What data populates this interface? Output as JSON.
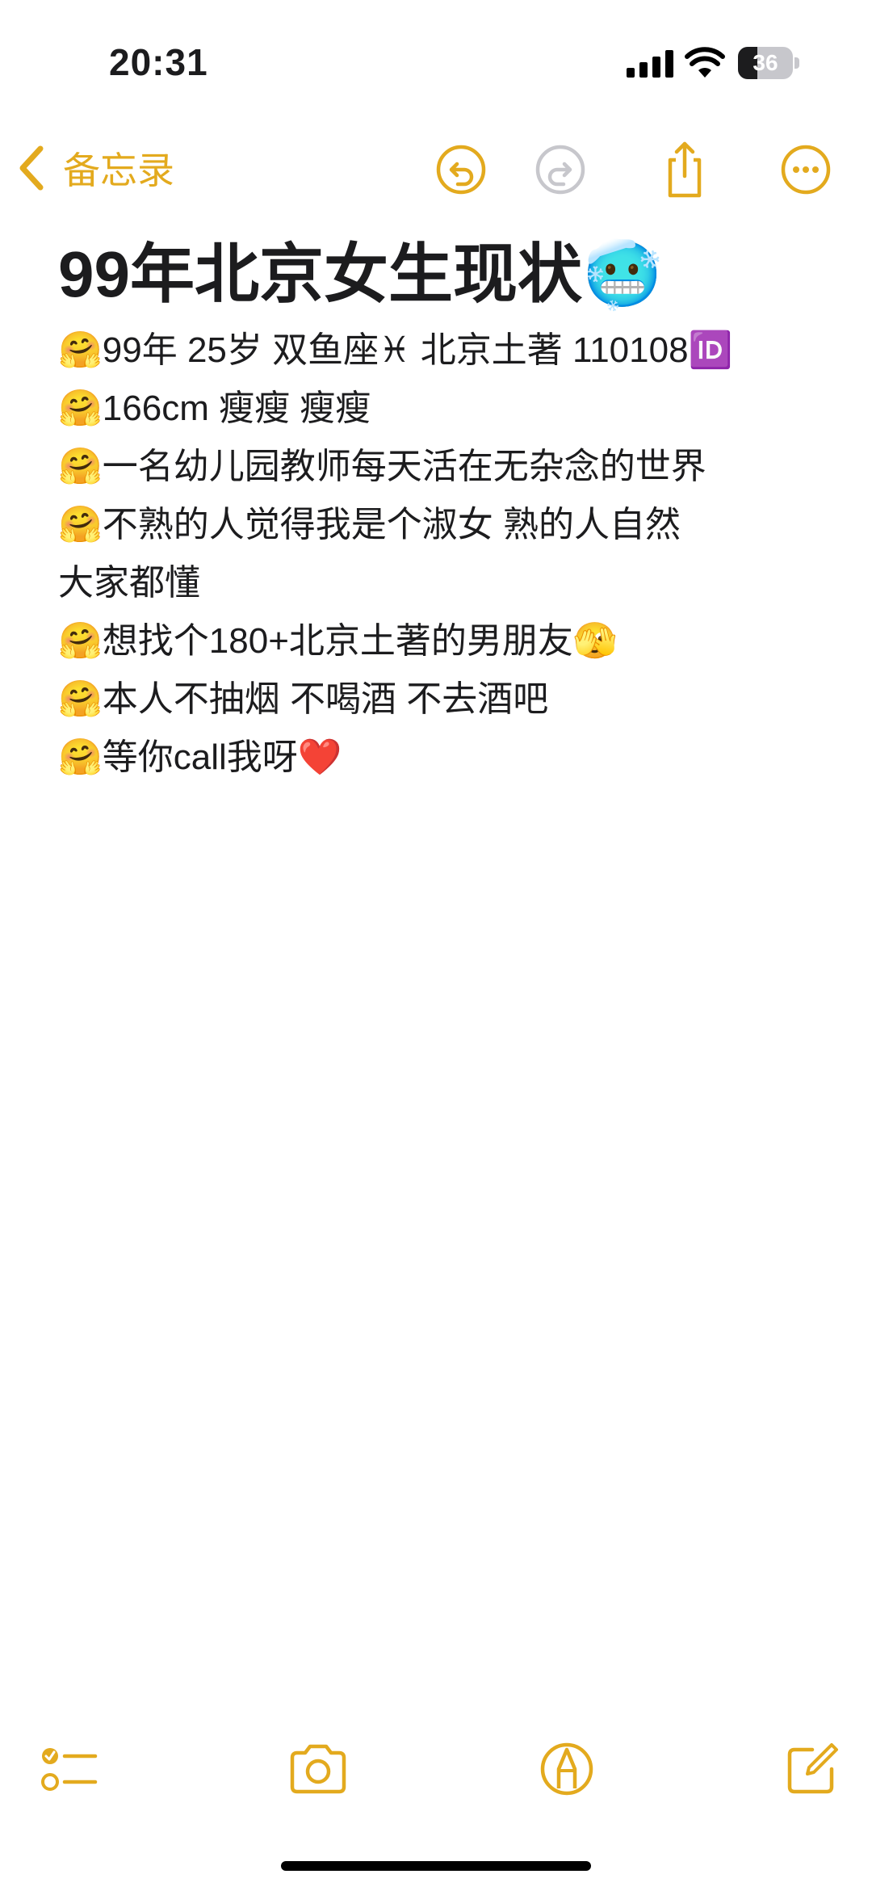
{
  "status": {
    "time": "20:31",
    "battery_text": "36",
    "battery_level": 0.36
  },
  "nav": {
    "back_label": "备忘录",
    "accent": "#e3aa1e",
    "icons": [
      "undo-icon",
      "redo-icon",
      "share-icon",
      "more-icon"
    ]
  },
  "note": {
    "title": "99年北京女生现状🥶",
    "lines": [
      "🤗99年 25岁 双鱼座♓ 北京土著 110108🆔",
      "🤗166cm 瘦瘦 瘦瘦",
      "🤗一名幼儿园教师每天活在无杂念的世界",
      "🤗不熟的人觉得我是个淑女 熟的人自然",
      "大家都懂",
      "🤗想找个180+北京土著的男朋友🫣",
      "🤗本人不抽烟 不喝酒 不去酒吧",
      "🤗等你call我呀❤️"
    ]
  },
  "toolbar": {
    "icons": [
      "checklist-icon",
      "camera-icon",
      "markup-icon",
      "compose-icon"
    ]
  }
}
